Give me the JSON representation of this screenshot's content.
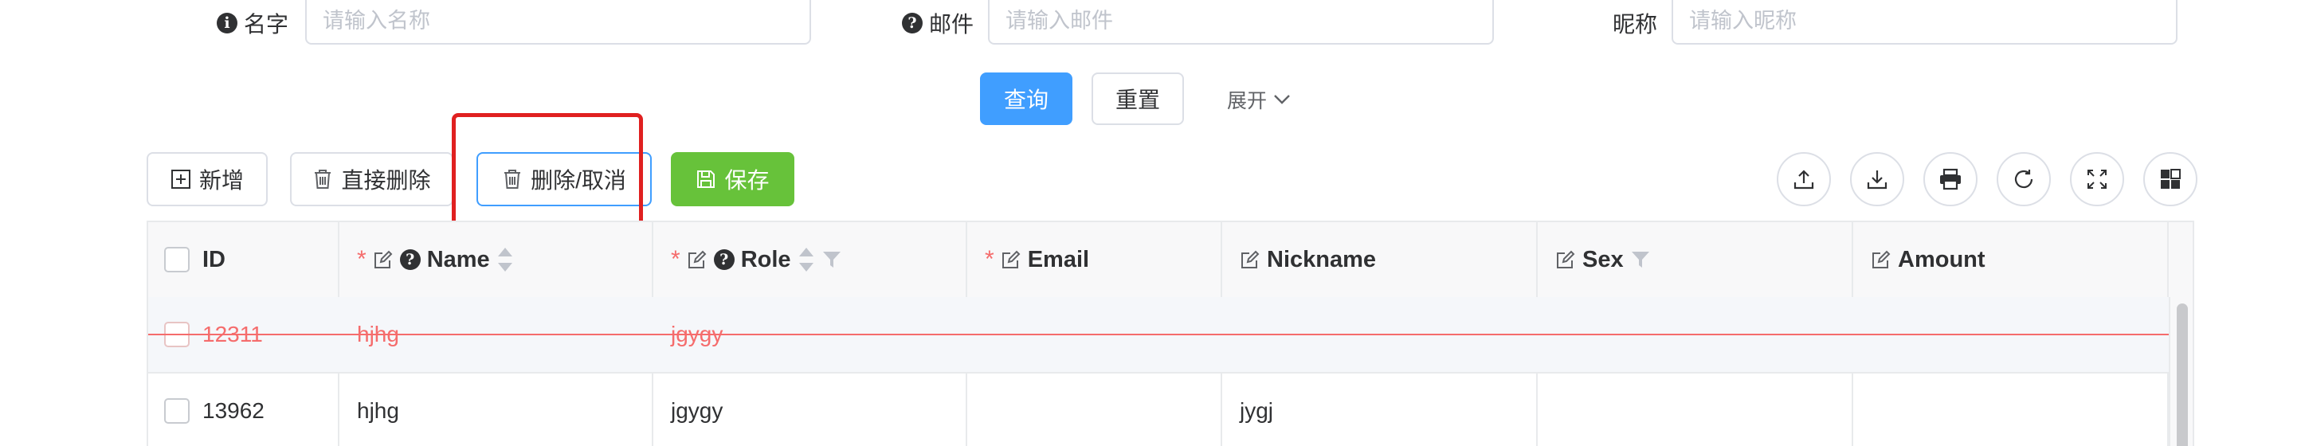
{
  "form": {
    "name_label": "名字",
    "name_placeholder": "请输入名称",
    "email_label": "邮件",
    "email_placeholder": "请输入邮件",
    "nickname_label": "昵称",
    "nickname_placeholder": "请输入昵称",
    "query_button": "查询",
    "reset_button": "重置",
    "expand_link": "展开"
  },
  "toolbar": {
    "add_button": "新增",
    "direct_delete_button": "直接删除",
    "delete_cancel_button": "删除/取消",
    "save_button": "保存",
    "right_icons": [
      "upload-icon",
      "download-icon",
      "print-icon",
      "refresh-icon",
      "fullscreen-icon",
      "column-settings-icon"
    ]
  },
  "table": {
    "headers": {
      "id": "ID",
      "name": "Name",
      "role": "Role",
      "email": "Email",
      "nickname": "Nickname",
      "sex": "Sex",
      "amount": "Amount"
    },
    "rows": [
      {
        "id": "12311",
        "name": "hjhg",
        "role": "jgygy",
        "email": "",
        "nickname": "",
        "sex": "",
        "amount": "",
        "status": "pending-delete"
      },
      {
        "id": "13962",
        "name": "hjhg",
        "role": "jgygy",
        "email": "",
        "nickname": "jygj",
        "sex": "",
        "amount": "",
        "status": "normal"
      }
    ]
  },
  "colors": {
    "primary": "#409eff",
    "success": "#67c23a",
    "danger": "#f56c6c",
    "highlight_box": "#e02020"
  }
}
